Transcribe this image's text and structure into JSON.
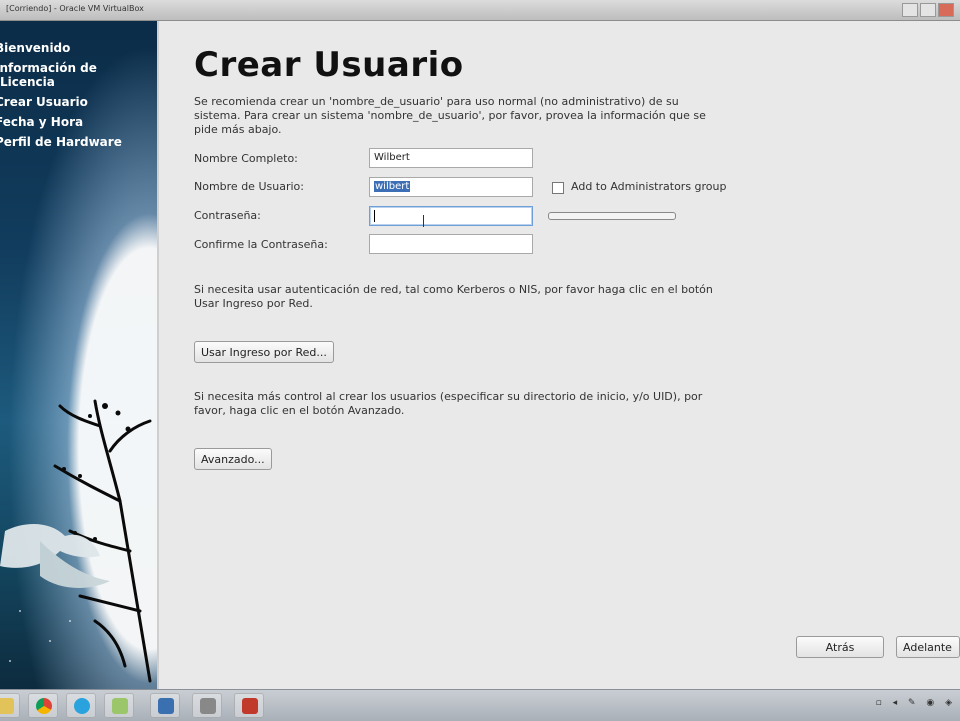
{
  "window": {
    "title": "[Corriendo] - Oracle VM VirtualBox"
  },
  "sidebar": {
    "items": [
      {
        "label": "Bienvenido"
      },
      {
        "label": "Información de Licencia"
      },
      {
        "label": "Crear Usuario"
      },
      {
        "label": "Fecha y Hora"
      },
      {
        "label": "Perfil de Hardware"
      }
    ]
  },
  "main": {
    "title": "Crear Usuario",
    "intro": "Se recomienda crear un 'nombre_de_usuario' para uso normal (no administrativo) de su sistema. Para crear un sistema 'nombre_de_usuario', por favor, provea la información que se pide más abajo.",
    "form": {
      "full_name_label": "Nombre Completo:",
      "full_name_value": "Wilbert",
      "username_label": "Nombre de Usuario:",
      "username_value": "wilbert",
      "password_label": "Contraseña:",
      "password_value": "",
      "confirm_label": "Confirme la Contraseña:",
      "confirm_value": "",
      "admin_checkbox_label": "Add to Administrators group",
      "admin_checked": false
    },
    "network_text": "Si necesita usar autenticación de red, tal como Kerberos o NIS, por favor haga clic en el botón Usar Ingreso por Red.",
    "network_button": "Usar Ingreso por Red...",
    "advanced_text": "Si necesita más control al crear los usuarios (especificar su directorio de inicio, y/o UID), por favor, haga clic en el botón Avanzado.",
    "advanced_button": "Avanzado..."
  },
  "footer": {
    "back_button": "Atrás",
    "forward_button": "Adelante"
  },
  "taskbar": {
    "icons": [
      "explorer-icon",
      "chrome-icon",
      "skype-icon",
      "notes-icon",
      "virtualbox-icon",
      "tool-icon",
      "app-icon"
    ]
  }
}
